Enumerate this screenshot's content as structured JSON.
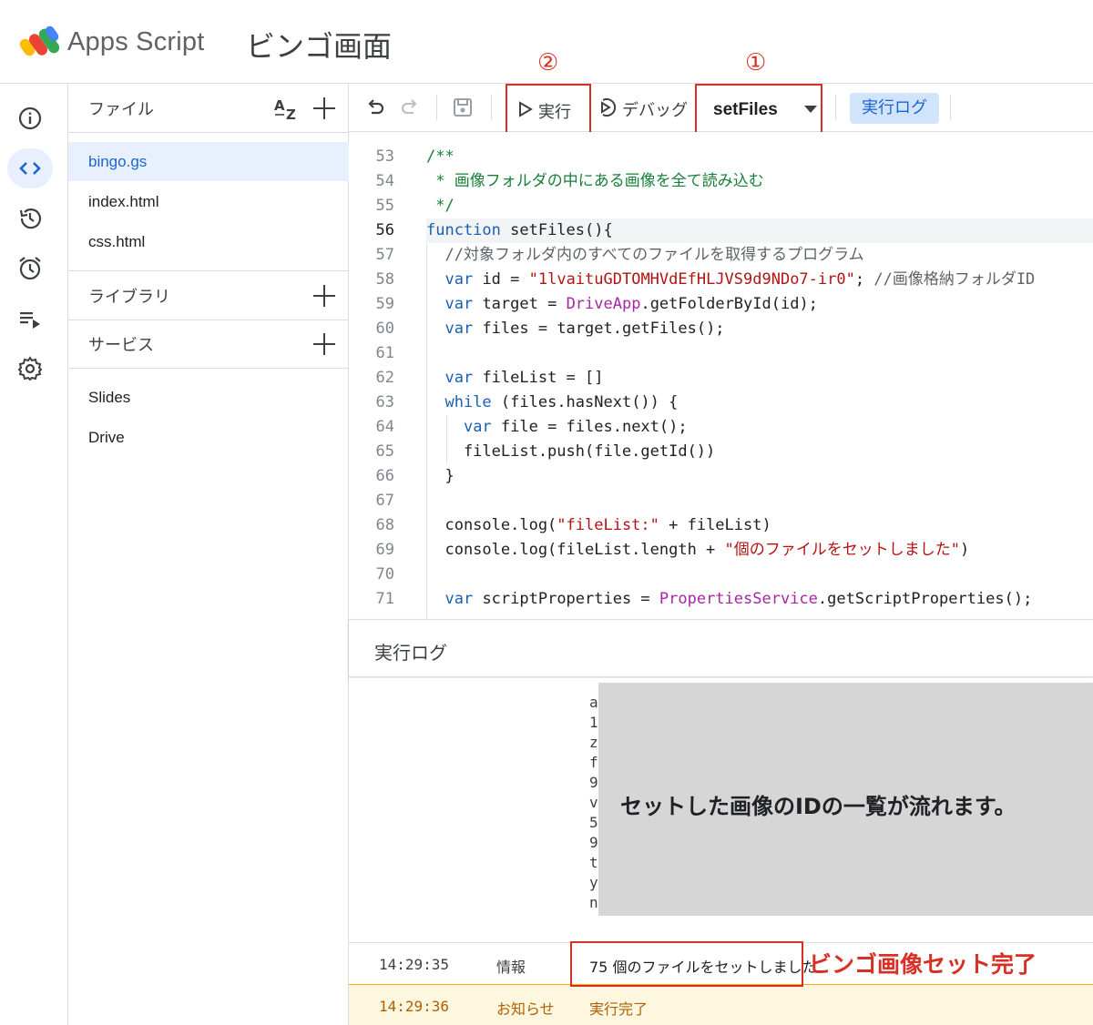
{
  "header": {
    "app_name": "Apps Script",
    "project_title": "ビンゴ画面"
  },
  "rail": {
    "items": [
      "info-icon",
      "code-icon",
      "history-icon",
      "alarm-icon",
      "executions-icon",
      "settings-icon"
    ],
    "active": "code-icon"
  },
  "files_panel": {
    "files_label": "ファイル",
    "files": [
      "bingo.gs",
      "index.html",
      "css.html"
    ],
    "active_file": "bingo.gs",
    "libraries_label": "ライブラリ",
    "services_label": "サービス",
    "services": [
      "Slides",
      "Drive"
    ]
  },
  "toolbar": {
    "run_label": "実行",
    "debug_label": "デバッグ",
    "selected_function": "setFiles",
    "exec_log_label": "実行ログ"
  },
  "annotations": {
    "marker_run": "②",
    "marker_function": "①",
    "overlay_text": "セットした画像のIDの一覧が流れます。",
    "complete_note": "ビンゴ画像セット完了"
  },
  "code": {
    "current_line": "56",
    "lines": [
      {
        "n": "53",
        "text": "/**"
      },
      {
        "n": "54",
        "text": " * 画像フォルダの中にある画像を全て読み込む"
      },
      {
        "n": "55",
        "text": " */"
      },
      {
        "n": "56",
        "text": "function setFiles(){"
      },
      {
        "n": "57",
        "text": "  //対象フォルダ内のすべてのファイルを取得するプログラム"
      },
      {
        "n": "58",
        "text": "  var id = \"1lvaituGDTOMHVdEfHLJVS9d9NDo7-ir0\"; //画像格納フォルダID"
      },
      {
        "n": "59",
        "text": "  var target = DriveApp.getFolderById(id);"
      },
      {
        "n": "60",
        "text": "  var files = target.getFiles();"
      },
      {
        "n": "61",
        "text": ""
      },
      {
        "n": "62",
        "text": "  var fileList = []"
      },
      {
        "n": "63",
        "text": "  while (files.hasNext()) {"
      },
      {
        "n": "64",
        "text": "    var file = files.next();"
      },
      {
        "n": "65",
        "text": "    fileList.push(file.getId())"
      },
      {
        "n": "66",
        "text": "  }"
      },
      {
        "n": "67",
        "text": ""
      },
      {
        "n": "68",
        "text": "  console.log(\"fileList:\" + fileList)"
      },
      {
        "n": "69",
        "text": "  console.log(fileList.length + \"個のファイルをセットしました\")"
      },
      {
        "n": "70",
        "text": ""
      },
      {
        "n": "71",
        "text": "  var scriptProperties = PropertiesService.getScriptProperties();"
      }
    ]
  },
  "log": {
    "title": "実行ログ",
    "partial_lines": [
      "a",
      "1",
      "z",
      "f",
      "9",
      "v",
      "5",
      "9",
      "t",
      "y",
      "n"
    ],
    "rows": [
      {
        "time": "14:29:35",
        "level": "情報",
        "message": "75 個のファイルをセットしました"
      },
      {
        "time": "14:29:36",
        "level": "お知らせ",
        "message": "実行完了"
      }
    ]
  },
  "colors": {
    "accent": "#1967d2",
    "annotation_red": "#d93025",
    "active_bg": "#e8f0fe",
    "notice_bg": "#fef7e0"
  }
}
